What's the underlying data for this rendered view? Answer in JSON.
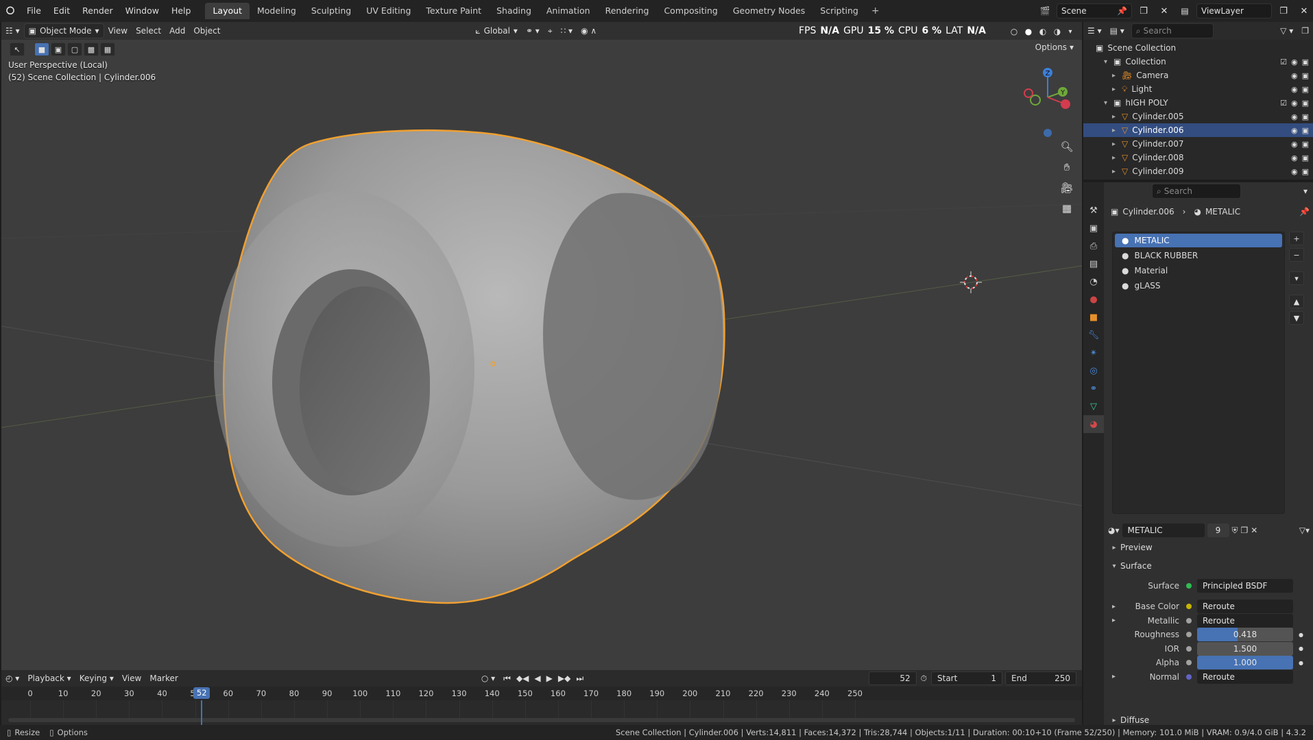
{
  "topbar": {
    "menus": [
      "File",
      "Edit",
      "Render",
      "Window",
      "Help"
    ],
    "workspaces": [
      "Layout",
      "Modeling",
      "Sculpting",
      "UV Editing",
      "Texture Paint",
      "Shading",
      "Animation",
      "Rendering",
      "Compositing",
      "Geometry Nodes",
      "Scripting"
    ],
    "active_workspace": "Layout",
    "scene": "Scene",
    "view_layer": "ViewLayer"
  },
  "viewport": {
    "mode": "Object Mode",
    "menus": [
      "View",
      "Select",
      "Add",
      "Object"
    ],
    "orientation": "Global",
    "options_label": "Options",
    "info_line1": "User Perspective (Local)",
    "info_line2": "(52) Scene Collection | Cylinder.006",
    "stats": {
      "fps": "FPS",
      "fps_val": "N/A",
      "gpu": "GPU",
      "gpu_val": "15 %",
      "cpu": "CPU",
      "cpu_val": "6 %",
      "lat": "LAT",
      "lat_val": "N/A"
    },
    "gizmo": {
      "z": "Z",
      "y": "Y"
    }
  },
  "timeline": {
    "menus": [
      "Playback",
      "Keying",
      "View",
      "Marker"
    ],
    "current_frame": "52",
    "start_label": "Start",
    "start": "1",
    "end_label": "End",
    "end": "250",
    "ticks": [
      0,
      10,
      20,
      30,
      40,
      50,
      60,
      70,
      80,
      90,
      100,
      110,
      120,
      130,
      140,
      150,
      160,
      170,
      180,
      190,
      200,
      210,
      220,
      230,
      240,
      250
    ]
  },
  "statusbar": {
    "left1": "Resize",
    "left2": "Options",
    "right": "Scene Collection | Cylinder.006 | Verts:14,811 | Faces:14,372 | Tris:28,744 | Objects:1/11 | Duration: 00:10+10 (Frame 52/250) | Memory: 101.0 MiB | VRAM: 0.9/4.0 GiB | 4.3.2"
  },
  "outliner": {
    "search_placeholder": "Search",
    "root": "Scene Collection",
    "rows": [
      {
        "label": "Collection",
        "level": 1,
        "type": "collection"
      },
      {
        "label": "Camera",
        "level": 2,
        "type": "camera"
      },
      {
        "label": "Light",
        "level": 2,
        "type": "light"
      },
      {
        "label": "hIGH POLY",
        "level": 1,
        "type": "collection"
      },
      {
        "label": "Cylinder.005",
        "level": 2,
        "type": "mesh"
      },
      {
        "label": "Cylinder.006",
        "level": 2,
        "type": "mesh",
        "selected": true
      },
      {
        "label": "Cylinder.007",
        "level": 2,
        "type": "mesh"
      },
      {
        "label": "Cylinder.008",
        "level": 2,
        "type": "mesh"
      },
      {
        "label": "Cylinder.009",
        "level": 2,
        "type": "mesh"
      }
    ]
  },
  "properties": {
    "search_placeholder": "Search",
    "breadcrumb_object": "Cylinder.006",
    "breadcrumb_material": "METALIC",
    "slots": [
      "METALIC",
      "BLACK RUBBER",
      "Material",
      "gLASS"
    ],
    "active_slot": "METALIC",
    "material_name": "METALIC",
    "users": "9",
    "preview_label": "Preview",
    "surface_label": "Surface",
    "surface_field_label": "Surface",
    "surface_shader": "Principled BSDF",
    "rows": [
      {
        "label": "Base Color",
        "value": "Reroute",
        "kind": "link",
        "dot": "#c7b500"
      },
      {
        "label": "Metallic",
        "value": "Reroute",
        "kind": "link",
        "dot": "#a1a1a1"
      },
      {
        "label": "Roughness",
        "value": "0.418",
        "kind": "slider",
        "fill": 0.418,
        "dot": "#a1a1a1"
      },
      {
        "label": "IOR",
        "value": "1.500",
        "kind": "slider",
        "fill": 0,
        "dot": "#a1a1a1"
      },
      {
        "label": "Alpha",
        "value": "1.000",
        "kind": "slider",
        "fill": 1.0,
        "dot": "#a1a1a1"
      },
      {
        "label": "Normal",
        "value": "Reroute",
        "kind": "link",
        "dot": "#6363c7"
      }
    ],
    "diffuse_label": "Diffuse"
  },
  "colors": {
    "accent": "#4772b3",
    "selection_outline": "#f0a030",
    "viewport_bg": "#3d3d3d"
  }
}
